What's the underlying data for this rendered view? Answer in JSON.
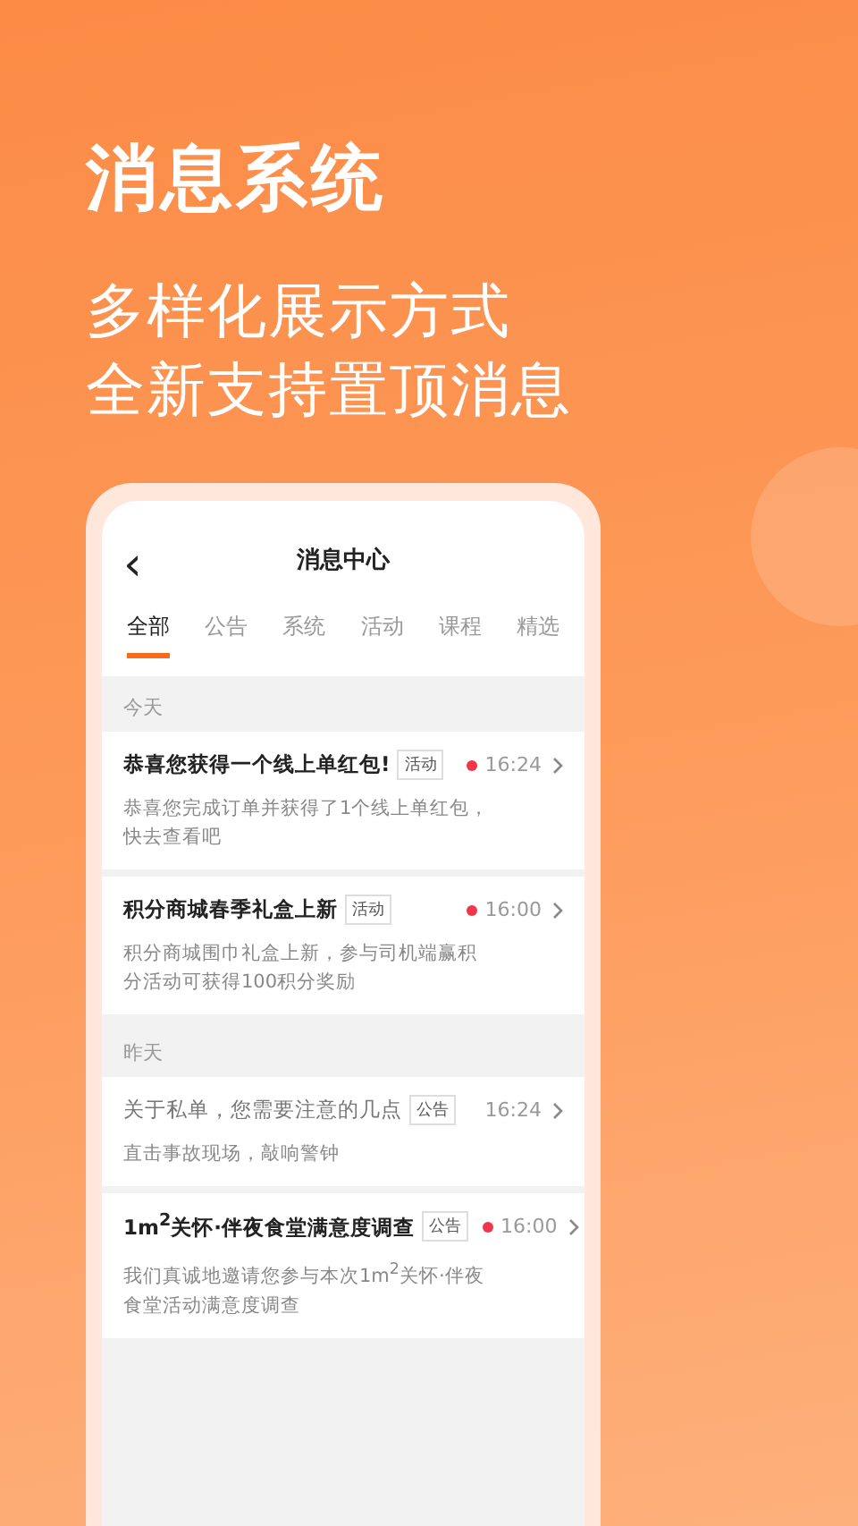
{
  "headline": "消息系统",
  "subtitle": [
    "多样化展示方式",
    "全新支持置顶消息"
  ],
  "screen": {
    "title": "消息中心",
    "back": "‹",
    "tabs": [
      {
        "label": "全部",
        "selected": true
      },
      {
        "label": "公告",
        "selected": false
      },
      {
        "label": "系统",
        "selected": false
      },
      {
        "label": "活动",
        "selected": false
      },
      {
        "label": "课程",
        "selected": false
      },
      {
        "label": "精选",
        "selected": false
      }
    ],
    "sections": [
      {
        "label": "今天",
        "messages": [
          {
            "title": "恭喜您获得一个线上单红包!",
            "tag": "活动",
            "time": "16:24",
            "unread": true,
            "body": "恭喜您完成订单并获得了1个线上单红包，快去查看吧"
          },
          {
            "title": "积分商城春季礼盒上新",
            "tag": "活动",
            "time": "16:00",
            "unread": true,
            "body": "积分商城围巾礼盒上新，参与司机端赢积分活动可获得100积分奖励"
          }
        ]
      },
      {
        "label": "昨天",
        "messages": [
          {
            "title": "关于私单，您需要注意的几点",
            "tag": "公告",
            "time": "16:24",
            "unread": false,
            "body": "直击事故现场，敲响警钟"
          },
          {
            "title": "1m$^{2}$关怀·伴夜食堂满意度调查",
            "tag": "公告",
            "time": "16:00",
            "unread": true,
            "body": "我们真诚地邀请您参与本次1m$^{2}$关怀·伴夜食堂活动满意度调查"
          }
        ]
      }
    ]
  }
}
